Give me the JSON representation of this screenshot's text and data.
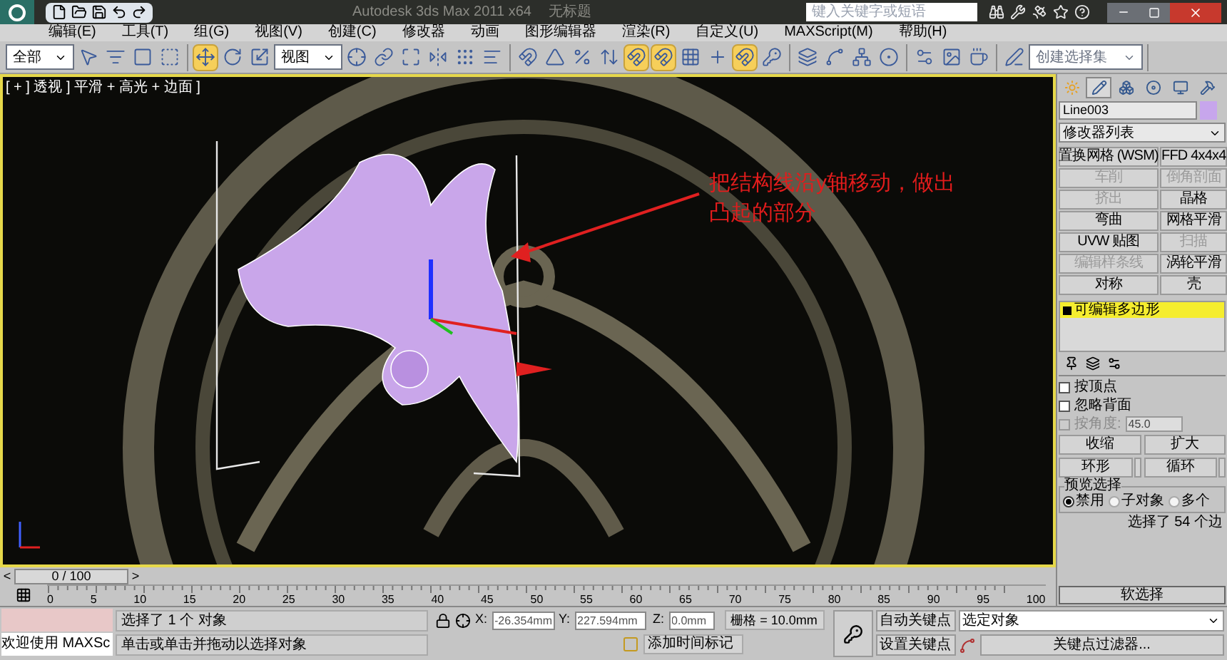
{
  "window": {
    "title": "Autodesk 3ds Max  2011 x64",
    "document": "无标题",
    "search": {
      "placeholder": "键入关键字或短语"
    }
  },
  "menu": [
    "编辑(E)",
    "工具(T)",
    "组(G)",
    "视图(V)",
    "创建(C)",
    "修改器",
    "动画",
    "图形编辑器",
    "渲染(R)",
    "自定义(U)",
    "MAXScript(M)",
    "帮助(H)"
  ],
  "toolbar": {
    "groups": [
      [
        {
          "kind": "dropdown",
          "value": "全部"
        },
        {
          "kind": "select",
          "selected": false
        },
        {
          "kind": "list",
          "selected": false
        },
        {
          "kind": "region",
          "selected": false
        },
        {
          "kind": "crossing",
          "selected": false
        }
      ],
      [
        {
          "kind": "move",
          "selected": true
        },
        {
          "kind": "rotate",
          "selected": false
        },
        {
          "kind": "scale",
          "selected": false
        },
        {
          "kind": "dropdown",
          "value": "视图"
        },
        {
          "kind": "pivot",
          "selected": false
        },
        {
          "kind": "link",
          "selected": false
        },
        {
          "kind": "manipulate",
          "selected": false
        },
        {
          "kind": "mirror",
          "selected": false
        },
        {
          "kind": "array",
          "selected": false
        },
        {
          "kind": "align",
          "selected": false
        }
      ],
      [
        {
          "kind": "snap",
          "selected": false
        },
        {
          "kind": "angle",
          "selected": false
        },
        {
          "kind": "percent",
          "selected": false
        },
        {
          "kind": "spinner",
          "selected": false
        },
        {
          "kind": "snap",
          "selected": true
        },
        {
          "kind": "snap",
          "selected": true
        },
        {
          "kind": "grid",
          "selected": false
        },
        {
          "kind": "plus",
          "selected": false
        },
        {
          "kind": "snap",
          "selected": true
        },
        {
          "kind": "key",
          "selected": false
        }
      ],
      [
        {
          "kind": "layers",
          "selected": false
        },
        {
          "kind": "curve",
          "selected": false
        },
        {
          "kind": "schematic",
          "selected": false
        },
        {
          "kind": "material",
          "selected": false
        }
      ],
      [
        {
          "kind": "render-setup",
          "selected": false
        },
        {
          "kind": "frame",
          "selected": false
        },
        {
          "kind": "render",
          "selected": false
        }
      ],
      [
        {
          "kind": "edit-set",
          "selected": false
        },
        {
          "kind": "dropdown",
          "placeholder": "创建选择集"
        }
      ]
    ]
  },
  "viewport": {
    "label": "[ + ] 透视 ] 平滑 + 高光 + 边面 ]",
    "annotation": "把结构线沿y轴移动，做出凸起的部分"
  },
  "command_panel": {
    "tabs": [
      {
        "kind": "create",
        "selected": false
      },
      {
        "kind": "modify",
        "selected": true
      },
      {
        "kind": "hierarchy",
        "selected": false
      },
      {
        "kind": "motion",
        "selected": false
      },
      {
        "kind": "display",
        "selected": false
      },
      {
        "kind": "utilities",
        "selected": false
      }
    ],
    "object_name": "Line003",
    "modifier_list": "修改器列表",
    "modifier_buttons": [
      {
        "label": "置换网格 (WSM)",
        "disabled": false
      },
      {
        "label": "FFD 4x4x4",
        "disabled": false
      },
      {
        "label": "车削",
        "disabled": true
      },
      {
        "label": "倒角剖面",
        "disabled": true
      },
      {
        "label": "挤出",
        "disabled": true
      },
      {
        "label": "晶格",
        "disabled": false
      },
      {
        "label": "弯曲",
        "disabled": false
      },
      {
        "label": "网格平滑",
        "disabled": false
      },
      {
        "label": "UVW 贴图",
        "disabled": false
      },
      {
        "label": "扫描",
        "disabled": true
      },
      {
        "label": "编辑样条线",
        "disabled": true
      },
      {
        "label": "涡轮平滑",
        "disabled": false
      },
      {
        "label": "对称",
        "disabled": false
      },
      {
        "label": "壳",
        "disabled": false
      }
    ],
    "stack": [
      {
        "label": "可编辑多边形",
        "selected": true
      }
    ],
    "selection": {
      "checkboxes": [
        {
          "label": "按顶点",
          "checked": false,
          "disabled": false
        },
        {
          "label": "忽略背面",
          "checked": false,
          "disabled": false
        },
        {
          "label": "按角度:",
          "checked": false,
          "disabled": true,
          "value": "45.0"
        }
      ],
      "buttons": [
        {
          "label": "收缩",
          "spinner": false
        },
        {
          "label": "扩大",
          "spinner": false
        },
        {
          "label": "环形",
          "spinner": true
        },
        {
          "label": "循环",
          "spinner": true
        }
      ],
      "preview": {
        "title": "预览选择",
        "options": [
          {
            "label": "禁用",
            "selected": true
          },
          {
            "label": "子对象",
            "selected": false
          },
          {
            "label": "多个",
            "selected": false
          }
        ]
      },
      "status": "选择了 54 个边"
    },
    "soft_selection": "软选择"
  },
  "time_slider": {
    "prev": "<",
    "position": "0 / 100",
    "next": ">"
  },
  "ruler": [
    "0",
    "5",
    "10",
    "15",
    "20",
    "25",
    "30",
    "35",
    "40",
    "45",
    "50",
    "55",
    "60",
    "65",
    "70",
    "75",
    "80",
    "85",
    "90",
    "95",
    "100"
  ],
  "status_bar": {
    "listener": "欢迎使用 MAXSc",
    "prompt_1": "选择了 1 个 对象",
    "prompt_2": "单击或单击并拖动以选择对象",
    "x_label": "X:",
    "x": "-26.354mm",
    "y_label": "Y:",
    "y": "227.594mm",
    "z_label": "Z:",
    "z": "0.0mm",
    "grid": "栅格 = 10.0mm",
    "time_tag": "添加时间标记",
    "auto_key": "自动关键点",
    "set_key": "设置关键点",
    "key_mode": "选定对象",
    "key_filters": "关键点过滤器..."
  }
}
